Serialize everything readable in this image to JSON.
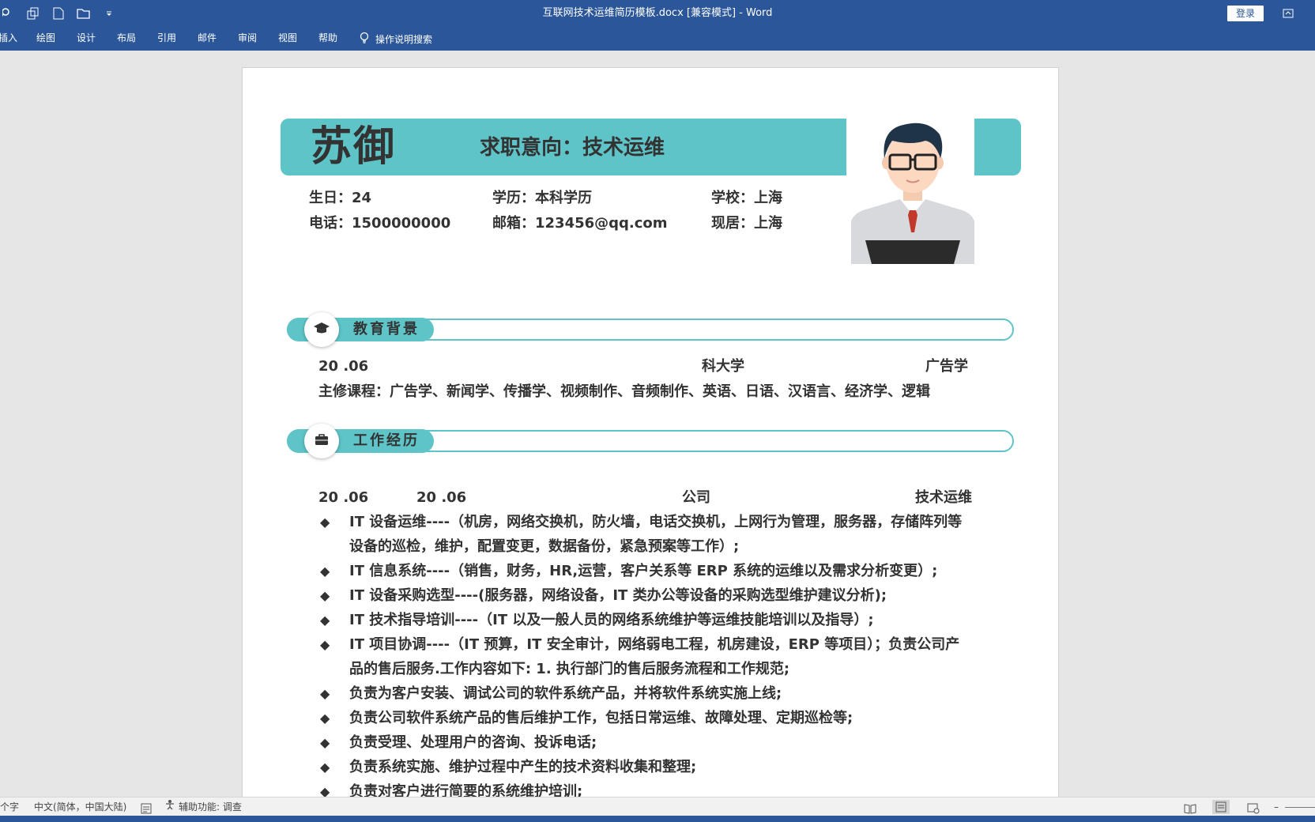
{
  "window": {
    "title": "互联网技术运维简历模板.docx [兼容模式]  -  Word",
    "login_label": "登录"
  },
  "ribbon": {
    "tabs": [
      "插入",
      "绘图",
      "设计",
      "布局",
      "引用",
      "邮件",
      "审阅",
      "视图",
      "帮助"
    ],
    "tell_me": "操作说明搜索"
  },
  "resume": {
    "name": "苏御",
    "intent": "求职意向：技术运维",
    "info": {
      "birthday": "生日：24",
      "phone": "电话：1500000000",
      "education": "学历：本科学历",
      "email": "邮箱：123456@qq.com",
      "school": "学校：上海",
      "residence": "现居：上海"
    },
    "education_section": {
      "title": "教育背景",
      "date": "20    .06",
      "school": "科大学",
      "major": "广告学",
      "courses": "主修课程：广告学、新闻学、传播学、视频制作、音频制作、英语、日语、汉语言、经济学、逻辑"
    },
    "work_section": {
      "title": "工作经历",
      "date_start": "20    .06",
      "date_end": "20    .06",
      "company": "公司",
      "position": "技术运维",
      "bullet_symbol": "◆",
      "bullets": [
        "IT  设备运维----（机房，网络交换机，防火墙，电话交换机，上网行为管理，服务器，存储阵列等设备的巡检，维护，配置变更，数据备份，紧急预案等工作）;",
        "IT 信息系统----（销售，财务，HR,运营，客户关系等 ERP 系统的运维以及需求分析变更）;",
        "IT 设备采购选型----(服务器，网络设备，IT 类办公等设备的采购选型维护建议分析);",
        "IT 技术指导培训----（IT 以及一般人员的网络系统维护等运维技能培训以及指导）;",
        "IT 项目协调----（IT 预算，IT 安全审计，网络弱电工程，机房建设，ERP 等项目）；负责公司产品的售后服务.工作内容如下: 1. 执行部门的售后服务流程和工作规范;",
        "负责为客户安装、调试公司的软件系统产品，并将软件系统实施上线;",
        "负责公司软件系统产品的售后维护工作，包括日常运维、故障处理、定期巡检等;",
        "负责受理、处理用户的咨询、投诉电话;",
        "负责系统实施、维护过程中产生的技术资料收集和整理;",
        "负责对客户进行简要的系统维护培训;"
      ]
    }
  },
  "statusbar": {
    "word_count": "个字",
    "language": "中文(简体，中国大陆)",
    "accessibility": "辅助功能: 调查"
  },
  "colors": {
    "ribbon": "#2b579a",
    "accent": "#5ec4c8"
  }
}
